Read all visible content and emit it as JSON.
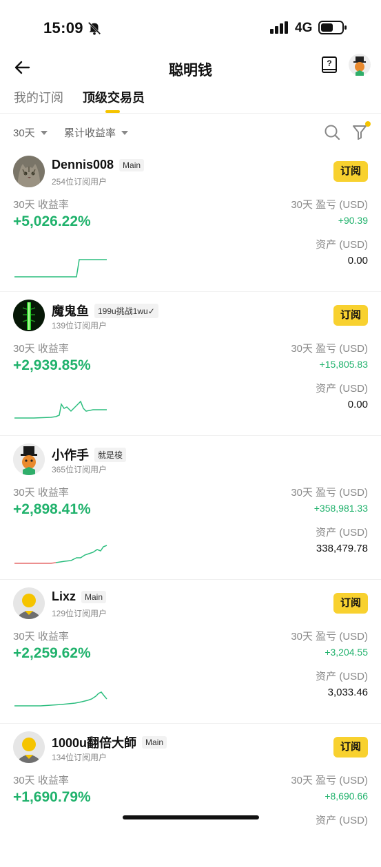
{
  "status_bar": {
    "time": "15:09",
    "network": "4G"
  },
  "header": {
    "title": "聪明钱"
  },
  "tabs": [
    {
      "label": "我的订阅"
    },
    {
      "label": "顶级交易员"
    }
  ],
  "filters": {
    "period": "30天",
    "metric": "累计收益率"
  },
  "colors": {
    "accent": "#f8d12f",
    "positive": "#20b26c"
  },
  "traders": [
    {
      "name": "Dennis008",
      "tag": "Main",
      "subs": "254位订阅用户",
      "subscribe": "订阅",
      "ret_label": "30天 收益率",
      "ret_value": "+5,026.22%",
      "pnl_label": "30天 盈亏 (USD)",
      "pnl_value": "+90.39",
      "asset_label": "资产 (USD)",
      "asset_value": "0.00",
      "avatar": "cat-photo"
    },
    {
      "name": "魔鬼鱼",
      "tag": "199u挑战1wu✓",
      "subs": "139位订阅用户",
      "subscribe": "订阅",
      "ret_label": "30天 收益率",
      "ret_value": "+2,939.85%",
      "pnl_label": "30天 盈亏 (USD)",
      "pnl_value": "+15,805.83",
      "asset_label": "资产 (USD)",
      "asset_value": "0.00",
      "avatar": "green-beam"
    },
    {
      "name": "小作手",
      "tag": "就是梭",
      "subs": "365位订阅用户",
      "subscribe": "",
      "ret_label": "30天 收益率",
      "ret_value": "+2,898.41%",
      "pnl_label": "30天 盈亏 (USD)",
      "pnl_value": "+358,981.33",
      "asset_label": "资产 (USD)",
      "asset_value": "338,479.78",
      "avatar": "top-hat-man"
    },
    {
      "name": "Lixz",
      "tag": "Main",
      "subs": "129位订阅用户",
      "subscribe": "订阅",
      "ret_label": "30天 收益率",
      "ret_value": "+2,259.62%",
      "pnl_label": "30天 盈亏 (USD)",
      "pnl_value": "+3,204.55",
      "asset_label": "资产 (USD)",
      "asset_value": "3,033.46",
      "avatar": "default-user"
    },
    {
      "name": "1000u翻倍大師",
      "tag": "Main",
      "subs": "134位订阅用户",
      "subscribe": "订阅",
      "ret_label": "30天 收益率",
      "ret_value": "+1,690.79%",
      "pnl_label": "30天 盈亏 (USD)",
      "pnl_value": "+8,690.66",
      "asset_label": "资产 (USD)",
      "asset_value": "",
      "avatar": "default-user"
    }
  ]
}
